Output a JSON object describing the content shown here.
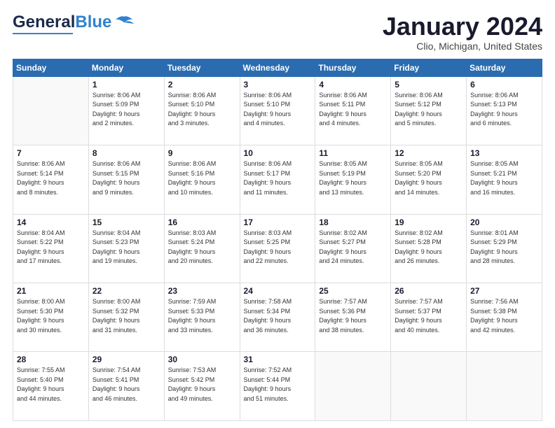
{
  "header": {
    "logo_general": "General",
    "logo_blue": "Blue",
    "title": "January 2024",
    "subtitle": "Clio, Michigan, United States"
  },
  "weekdays": [
    "Sunday",
    "Monday",
    "Tuesday",
    "Wednesday",
    "Thursday",
    "Friday",
    "Saturday"
  ],
  "weeks": [
    [
      {
        "day": "",
        "info": ""
      },
      {
        "day": "1",
        "info": "Sunrise: 8:06 AM\nSunset: 5:09 PM\nDaylight: 9 hours\nand 2 minutes."
      },
      {
        "day": "2",
        "info": "Sunrise: 8:06 AM\nSunset: 5:10 PM\nDaylight: 9 hours\nand 3 minutes."
      },
      {
        "day": "3",
        "info": "Sunrise: 8:06 AM\nSunset: 5:10 PM\nDaylight: 9 hours\nand 4 minutes."
      },
      {
        "day": "4",
        "info": "Sunrise: 8:06 AM\nSunset: 5:11 PM\nDaylight: 9 hours\nand 4 minutes."
      },
      {
        "day": "5",
        "info": "Sunrise: 8:06 AM\nSunset: 5:12 PM\nDaylight: 9 hours\nand 5 minutes."
      },
      {
        "day": "6",
        "info": "Sunrise: 8:06 AM\nSunset: 5:13 PM\nDaylight: 9 hours\nand 6 minutes."
      }
    ],
    [
      {
        "day": "7",
        "info": "Sunrise: 8:06 AM\nSunset: 5:14 PM\nDaylight: 9 hours\nand 8 minutes."
      },
      {
        "day": "8",
        "info": "Sunrise: 8:06 AM\nSunset: 5:15 PM\nDaylight: 9 hours\nand 9 minutes."
      },
      {
        "day": "9",
        "info": "Sunrise: 8:06 AM\nSunset: 5:16 PM\nDaylight: 9 hours\nand 10 minutes."
      },
      {
        "day": "10",
        "info": "Sunrise: 8:06 AM\nSunset: 5:17 PM\nDaylight: 9 hours\nand 11 minutes."
      },
      {
        "day": "11",
        "info": "Sunrise: 8:05 AM\nSunset: 5:19 PM\nDaylight: 9 hours\nand 13 minutes."
      },
      {
        "day": "12",
        "info": "Sunrise: 8:05 AM\nSunset: 5:20 PM\nDaylight: 9 hours\nand 14 minutes."
      },
      {
        "day": "13",
        "info": "Sunrise: 8:05 AM\nSunset: 5:21 PM\nDaylight: 9 hours\nand 16 minutes."
      }
    ],
    [
      {
        "day": "14",
        "info": "Sunrise: 8:04 AM\nSunset: 5:22 PM\nDaylight: 9 hours\nand 17 minutes."
      },
      {
        "day": "15",
        "info": "Sunrise: 8:04 AM\nSunset: 5:23 PM\nDaylight: 9 hours\nand 19 minutes."
      },
      {
        "day": "16",
        "info": "Sunrise: 8:03 AM\nSunset: 5:24 PM\nDaylight: 9 hours\nand 20 minutes."
      },
      {
        "day": "17",
        "info": "Sunrise: 8:03 AM\nSunset: 5:25 PM\nDaylight: 9 hours\nand 22 minutes."
      },
      {
        "day": "18",
        "info": "Sunrise: 8:02 AM\nSunset: 5:27 PM\nDaylight: 9 hours\nand 24 minutes."
      },
      {
        "day": "19",
        "info": "Sunrise: 8:02 AM\nSunset: 5:28 PM\nDaylight: 9 hours\nand 26 minutes."
      },
      {
        "day": "20",
        "info": "Sunrise: 8:01 AM\nSunset: 5:29 PM\nDaylight: 9 hours\nand 28 minutes."
      }
    ],
    [
      {
        "day": "21",
        "info": "Sunrise: 8:00 AM\nSunset: 5:30 PM\nDaylight: 9 hours\nand 30 minutes."
      },
      {
        "day": "22",
        "info": "Sunrise: 8:00 AM\nSunset: 5:32 PM\nDaylight: 9 hours\nand 31 minutes."
      },
      {
        "day": "23",
        "info": "Sunrise: 7:59 AM\nSunset: 5:33 PM\nDaylight: 9 hours\nand 33 minutes."
      },
      {
        "day": "24",
        "info": "Sunrise: 7:58 AM\nSunset: 5:34 PM\nDaylight: 9 hours\nand 36 minutes."
      },
      {
        "day": "25",
        "info": "Sunrise: 7:57 AM\nSunset: 5:36 PM\nDaylight: 9 hours\nand 38 minutes."
      },
      {
        "day": "26",
        "info": "Sunrise: 7:57 AM\nSunset: 5:37 PM\nDaylight: 9 hours\nand 40 minutes."
      },
      {
        "day": "27",
        "info": "Sunrise: 7:56 AM\nSunset: 5:38 PM\nDaylight: 9 hours\nand 42 minutes."
      }
    ],
    [
      {
        "day": "28",
        "info": "Sunrise: 7:55 AM\nSunset: 5:40 PM\nDaylight: 9 hours\nand 44 minutes."
      },
      {
        "day": "29",
        "info": "Sunrise: 7:54 AM\nSunset: 5:41 PM\nDaylight: 9 hours\nand 46 minutes."
      },
      {
        "day": "30",
        "info": "Sunrise: 7:53 AM\nSunset: 5:42 PM\nDaylight: 9 hours\nand 49 minutes."
      },
      {
        "day": "31",
        "info": "Sunrise: 7:52 AM\nSunset: 5:44 PM\nDaylight: 9 hours\nand 51 minutes."
      },
      {
        "day": "",
        "info": ""
      },
      {
        "day": "",
        "info": ""
      },
      {
        "day": "",
        "info": ""
      }
    ]
  ]
}
